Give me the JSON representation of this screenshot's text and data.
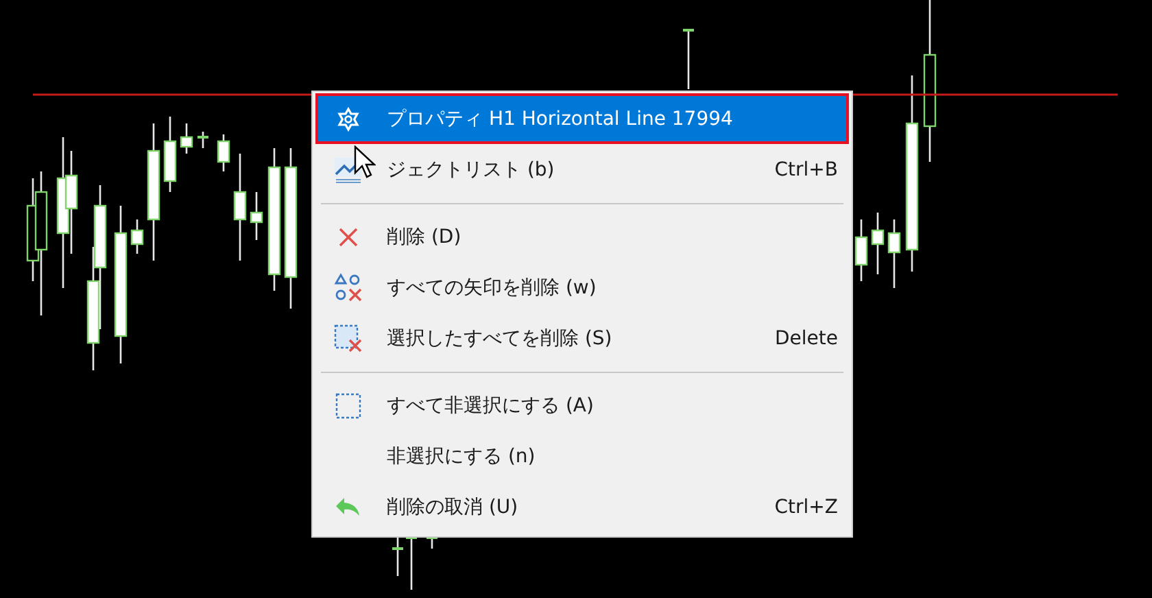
{
  "menu": {
    "items": [
      {
        "kind": "item",
        "label": "プロパティ H1 Horizontal Line 17994",
        "selected": true
      },
      {
        "kind": "item",
        "label": "ジェクトリスト (b)",
        "shortcut": "Ctrl+B",
        "selected": false
      },
      {
        "kind": "separator"
      },
      {
        "kind": "item",
        "label": "削除 (D)",
        "selected": false
      },
      {
        "kind": "item",
        "label": "すべての矢印を削除 (w)",
        "selected": false
      },
      {
        "kind": "item",
        "label": "選択したすべてを削除 (S)",
        "shortcut": "Delete",
        "selected": false
      },
      {
        "kind": "separator"
      },
      {
        "kind": "item",
        "label": "すべて非選択にする (A)",
        "selected": false
      },
      {
        "kind": "item",
        "label": "非選択にする (n)",
        "selected": false
      },
      {
        "kind": "item",
        "label": "削除の取消 (U)",
        "shortcut": "Ctrl+Z",
        "selected": false
      }
    ]
  }
}
